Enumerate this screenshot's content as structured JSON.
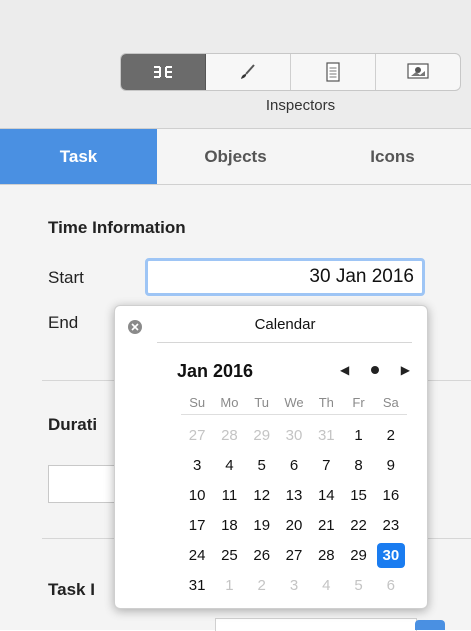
{
  "toolbar": {
    "segments": [
      {
        "icon": "inspector-grid-icon",
        "active": true
      },
      {
        "icon": "brush-icon",
        "active": false
      },
      {
        "icon": "document-icon",
        "active": false
      },
      {
        "icon": "image-icon",
        "active": false
      }
    ],
    "label": "Inspectors"
  },
  "tabs": [
    {
      "label": "Task",
      "active": true
    },
    {
      "label": "Objects",
      "active": false
    },
    {
      "label": "Icons",
      "active": false
    }
  ],
  "time_info": {
    "title": "Time Information",
    "start_label": "Start",
    "start_value": "30 Jan 2016",
    "end_label": "End"
  },
  "duration": {
    "title": "Durati"
  },
  "task_info": {
    "title": "Task I"
  },
  "calendar": {
    "title": "Calendar",
    "month": "Jan 2016",
    "nav_prev": "◀",
    "nav_next": "▶",
    "weekdays": [
      "Su",
      "Mo",
      "Tu",
      "We",
      "Th",
      "Fr",
      "Sa"
    ],
    "days": [
      {
        "d": "27",
        "muted": true
      },
      {
        "d": "28",
        "muted": true
      },
      {
        "d": "29",
        "muted": true
      },
      {
        "d": "30",
        "muted": true
      },
      {
        "d": "31",
        "muted": true
      },
      {
        "d": "1"
      },
      {
        "d": "2"
      },
      {
        "d": "3"
      },
      {
        "d": "4"
      },
      {
        "d": "5"
      },
      {
        "d": "6"
      },
      {
        "d": "7"
      },
      {
        "d": "8"
      },
      {
        "d": "9"
      },
      {
        "d": "10"
      },
      {
        "d": "11"
      },
      {
        "d": "12"
      },
      {
        "d": "13"
      },
      {
        "d": "14"
      },
      {
        "d": "15"
      },
      {
        "d": "16"
      },
      {
        "d": "17"
      },
      {
        "d": "18"
      },
      {
        "d": "19"
      },
      {
        "d": "20"
      },
      {
        "d": "21"
      },
      {
        "d": "22"
      },
      {
        "d": "23"
      },
      {
        "d": "24"
      },
      {
        "d": "25"
      },
      {
        "d": "26"
      },
      {
        "d": "27"
      },
      {
        "d": "28"
      },
      {
        "d": "29"
      },
      {
        "d": "30",
        "selected": true
      },
      {
        "d": "31"
      },
      {
        "d": "1",
        "muted": true
      },
      {
        "d": "2",
        "muted": true
      },
      {
        "d": "3",
        "muted": true
      },
      {
        "d": "4",
        "muted": true
      },
      {
        "d": "5",
        "muted": true
      },
      {
        "d": "6",
        "muted": true
      }
    ]
  },
  "colors": {
    "accent": "#4a90e2",
    "selected_day": "#1a7cf0"
  }
}
